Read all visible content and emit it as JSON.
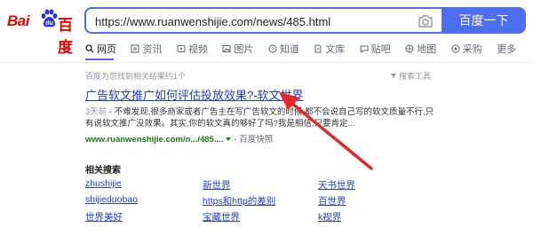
{
  "logo": {
    "bai": "Bai",
    "du": "百度"
  },
  "search": {
    "query": "https://www.ruanwenshijie.com/news/485.html",
    "button_label": "百度一下"
  },
  "tabs": [
    {
      "label": "网页",
      "icon": "search-icon",
      "active": true
    },
    {
      "label": "资讯",
      "icon": "news-icon"
    },
    {
      "label": "视频",
      "icon": "video-icon"
    },
    {
      "label": "图片",
      "icon": "image-icon"
    },
    {
      "label": "知道",
      "icon": "question-icon"
    },
    {
      "label": "文库",
      "icon": "document-icon"
    },
    {
      "label": "贴吧",
      "icon": "forum-icon"
    },
    {
      "label": "地图",
      "icon": "map-icon"
    },
    {
      "label": "采购",
      "icon": "purchase-icon"
    },
    {
      "label": "更多"
    }
  ],
  "result_count": "百度为您找到相关结果约1个",
  "search_tools": "搜索工具",
  "result": {
    "title": "广告软文推广如何评估投放效果?-软文世界",
    "date": "3天前",
    "snippet": "- 不难发现,很多商家或者广告主在写广告软文的时候,都不会说自己写的软文质量不行,只有说软文推广没效果。其实,你的软文真的够好了吗?我是相信,只要肯定...",
    "url": "www.ruanwenshijie.com/n.../485....",
    "snapshot": "百度快照"
  },
  "related": {
    "title": "相关搜索",
    "items": [
      "zhushijie",
      "新世界",
      "天书世界",
      "shijieduobao",
      "https和http的差别",
      "百世界",
      "世界美好",
      "宝藏世界",
      "k视界"
    ]
  },
  "colors": {
    "brand_red": "#e10602",
    "accent_blue": "#4e6ef2",
    "link_blue": "#2440b3",
    "url_green": "#1b7a0f",
    "arrow_red": "#e4292b"
  }
}
